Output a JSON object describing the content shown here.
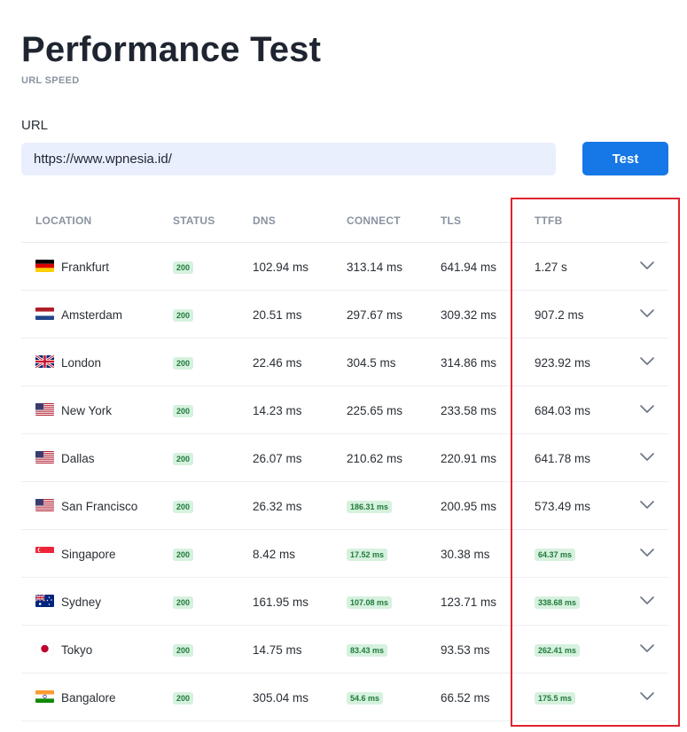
{
  "header": {
    "title": "Performance Test",
    "subtitle": "URL SPEED"
  },
  "form": {
    "url_label": "URL",
    "url_value": "https://www.wpnesia.id/",
    "test_button_label": "Test"
  },
  "table": {
    "headers": {
      "location": "LOCATION",
      "status": "STATUS",
      "dns": "DNS",
      "connect": "CONNECT",
      "tls": "TLS",
      "ttfb": "TTFB"
    },
    "rows": [
      {
        "location": "Frankfurt",
        "flag": "flag-germany-icon",
        "status": "200",
        "dns": "102.94 ms",
        "connect": "313.14 ms",
        "connect_fast": false,
        "tls": "641.94 ms",
        "ttfb": "1.27 s",
        "ttfb_fast": false
      },
      {
        "location": "Amsterdam",
        "flag": "flag-netherlands-icon",
        "status": "200",
        "dns": "20.51 ms",
        "connect": "297.67 ms",
        "connect_fast": false,
        "tls": "309.32 ms",
        "ttfb": "907.2 ms",
        "ttfb_fast": false
      },
      {
        "location": "London",
        "flag": "flag-uk-icon",
        "status": "200",
        "dns": "22.46 ms",
        "connect": "304.5 ms",
        "connect_fast": false,
        "tls": "314.86 ms",
        "ttfb": "923.92 ms",
        "ttfb_fast": false
      },
      {
        "location": "New York",
        "flag": "flag-usa-icon",
        "status": "200",
        "dns": "14.23 ms",
        "connect": "225.65 ms",
        "connect_fast": false,
        "tls": "233.58 ms",
        "ttfb": "684.03 ms",
        "ttfb_fast": false
      },
      {
        "location": "Dallas",
        "flag": "flag-usa-icon",
        "status": "200",
        "dns": "26.07 ms",
        "connect": "210.62 ms",
        "connect_fast": false,
        "tls": "220.91 ms",
        "ttfb": "641.78 ms",
        "ttfb_fast": false
      },
      {
        "location": "San Francisco",
        "flag": "flag-usa-icon",
        "status": "200",
        "dns": "26.32 ms",
        "connect": "186.31 ms",
        "connect_fast": true,
        "tls": "200.95 ms",
        "ttfb": "573.49 ms",
        "ttfb_fast": false
      },
      {
        "location": "Singapore",
        "flag": "flag-singapore-icon",
        "status": "200",
        "dns": "8.42 ms",
        "connect": "17.52 ms",
        "connect_fast": true,
        "tls": "30.38 ms",
        "ttfb": "64.37 ms",
        "ttfb_fast": true
      },
      {
        "location": "Sydney",
        "flag": "flag-australia-icon",
        "status": "200",
        "dns": "161.95 ms",
        "connect": "107.08 ms",
        "connect_fast": true,
        "tls": "123.71 ms",
        "ttfb": "338.68 ms",
        "ttfb_fast": true
      },
      {
        "location": "Tokyo",
        "flag": "flag-japan-icon",
        "status": "200",
        "dns": "14.75 ms",
        "connect": "83.43 ms",
        "connect_fast": true,
        "tls": "93.53 ms",
        "ttfb": "262.41 ms",
        "ttfb_fast": true
      },
      {
        "location": "Bangalore",
        "flag": "flag-india-icon",
        "status": "200",
        "dns": "305.04 ms",
        "connect": "54.6 ms",
        "connect_fast": true,
        "tls": "66.52 ms",
        "ttfb": "175.5 ms",
        "ttfb_fast": true
      }
    ]
  },
  "colors": {
    "accent": "#1677e6",
    "badge_bg": "#d6f1de",
    "badge_text": "#1f7a3a",
    "highlight_border": "#e0232f"
  }
}
